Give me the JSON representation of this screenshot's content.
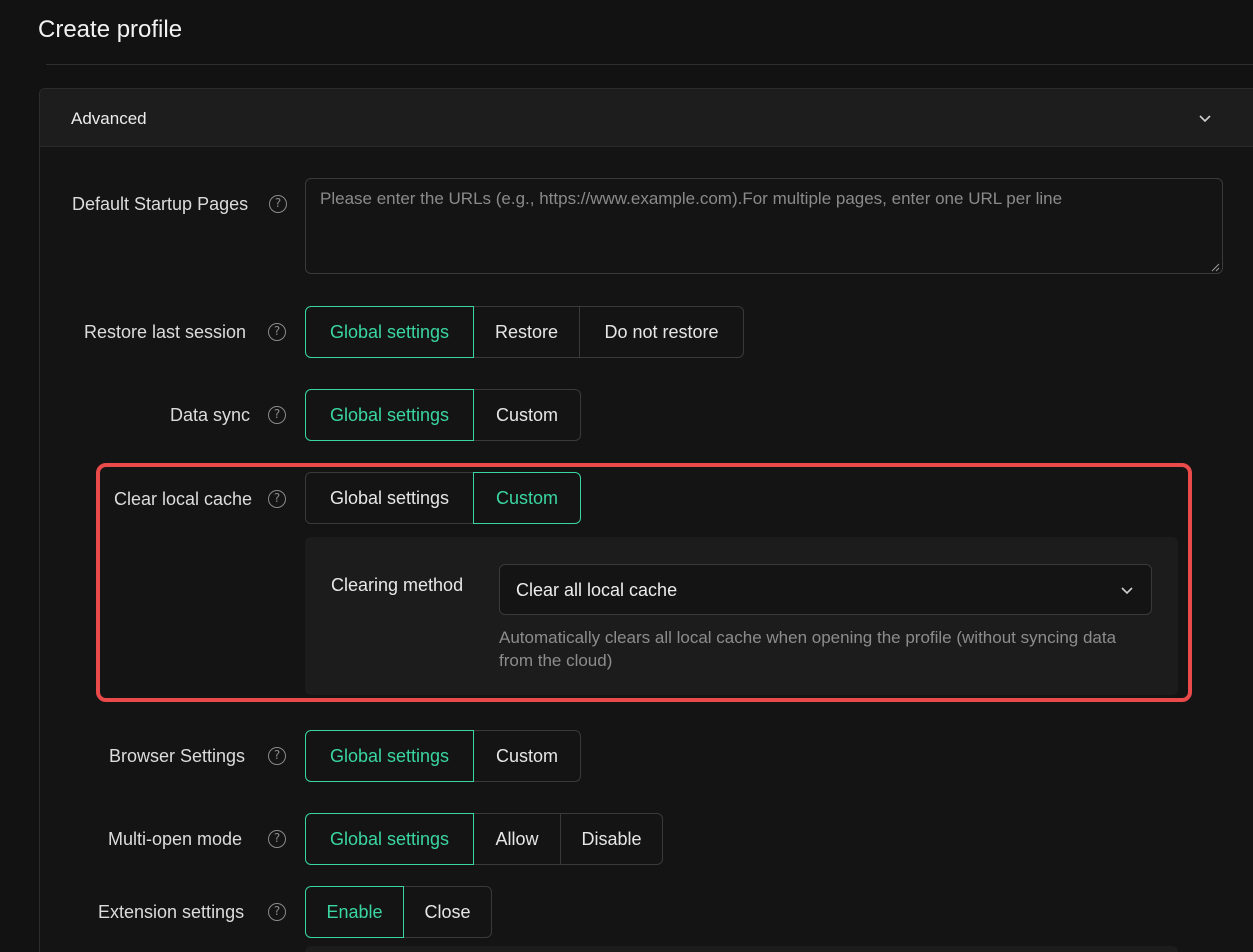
{
  "page": {
    "title": "Create profile"
  },
  "panel": {
    "header_label": "Advanced"
  },
  "startup_pages": {
    "label": "Default Startup Pages",
    "placeholder": "Please enter the URLs (e.g., https://www.example.com).For multiple pages, enter one URL per line",
    "value": ""
  },
  "restore_session": {
    "label": "Restore last session",
    "options": [
      "Global settings",
      "Restore",
      "Do not restore"
    ],
    "selected": "Global settings"
  },
  "data_sync": {
    "label": "Data sync",
    "options": [
      "Global settings",
      "Custom"
    ],
    "selected": "Global settings"
  },
  "clear_cache": {
    "label": "Clear local cache",
    "options": [
      "Global settings",
      "Custom"
    ],
    "selected": "Custom",
    "clearing_method": {
      "label": "Clearing method",
      "value": "Clear all local cache",
      "help": "Automatically clears all local cache when opening the profile (without syncing data from the cloud)"
    }
  },
  "browser_settings": {
    "label": "Browser Settings",
    "options": [
      "Global settings",
      "Custom"
    ],
    "selected": "Global settings"
  },
  "multi_open": {
    "label": "Multi-open mode",
    "options": [
      "Global settings",
      "Allow",
      "Disable"
    ],
    "selected": "Global settings"
  },
  "extension_settings": {
    "label": "Extension settings",
    "options": [
      "Enable",
      "Close"
    ],
    "selected": "Enable"
  },
  "colors": {
    "accent": "#3ad6a0",
    "highlight": "#ea4a4a",
    "background": "#121212"
  },
  "icons": {
    "help": "help-circle-icon",
    "chevron": "chevron-down-icon"
  }
}
